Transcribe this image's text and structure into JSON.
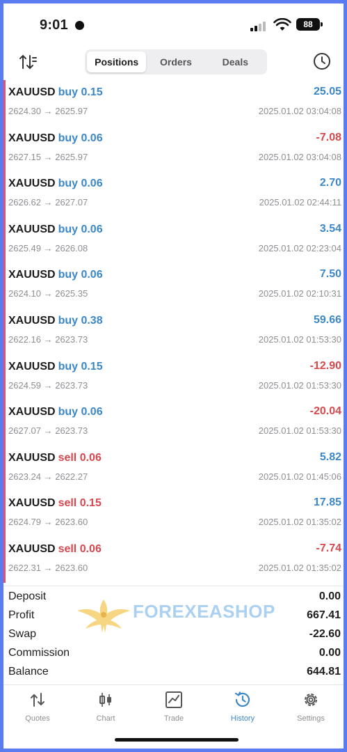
{
  "status_bar": {
    "time": "9:01",
    "battery": "88"
  },
  "toolbar": {
    "tabs": [
      {
        "label": "Positions",
        "active": true
      },
      {
        "label": "Orders",
        "active": false
      },
      {
        "label": "Deals",
        "active": false
      }
    ],
    "sort_icon": "sort-icon",
    "history_icon": "clock-icon"
  },
  "deals": [
    {
      "symbol": "XAUUSD",
      "side": "buy 0.15",
      "direction": "buy",
      "prices": "2624.30 → 2625.97",
      "profit": "25.05",
      "sign": "pos",
      "date": "2025.01.02 03:04:08"
    },
    {
      "symbol": "XAUUSD",
      "side": "buy 0.06",
      "direction": "buy",
      "prices": "2627.15 → 2625.97",
      "profit": "-7.08",
      "sign": "neg",
      "date": "2025.01.02 03:04:08"
    },
    {
      "symbol": "XAUUSD",
      "side": "buy 0.06",
      "direction": "buy",
      "prices": "2626.62 → 2627.07",
      "profit": "2.70",
      "sign": "pos",
      "date": "2025.01.02 02:44:11"
    },
    {
      "symbol": "XAUUSD",
      "side": "buy 0.06",
      "direction": "buy",
      "prices": "2625.49 → 2626.08",
      "profit": "3.54",
      "sign": "pos",
      "date": "2025.01.02 02:23:04"
    },
    {
      "symbol": "XAUUSD",
      "side": "buy 0.06",
      "direction": "buy",
      "prices": "2624.10 → 2625.35",
      "profit": "7.50",
      "sign": "pos",
      "date": "2025.01.02 02:10:31"
    },
    {
      "symbol": "XAUUSD",
      "side": "buy 0.38",
      "direction": "buy",
      "prices": "2622.16 → 2623.73",
      "profit": "59.66",
      "sign": "pos",
      "date": "2025.01.02 01:53:30"
    },
    {
      "symbol": "XAUUSD",
      "side": "buy 0.15",
      "direction": "buy",
      "prices": "2624.59 → 2623.73",
      "profit": "-12.90",
      "sign": "neg",
      "date": "2025.01.02 01:53:30"
    },
    {
      "symbol": "XAUUSD",
      "side": "buy 0.06",
      "direction": "buy",
      "prices": "2627.07 → 2623.73",
      "profit": "-20.04",
      "sign": "neg",
      "date": "2025.01.02 01:53:30"
    },
    {
      "symbol": "XAUUSD",
      "side": "sell 0.06",
      "direction": "sell",
      "prices": "2623.24 → 2622.27",
      "profit": "5.82",
      "sign": "pos",
      "date": "2025.01.02 01:45:06"
    },
    {
      "symbol": "XAUUSD",
      "side": "sell 0.15",
      "direction": "sell",
      "prices": "2624.79 → 2623.60",
      "profit": "17.85",
      "sign": "pos",
      "date": "2025.01.02 01:35:02"
    },
    {
      "symbol": "XAUUSD",
      "side": "sell 0.06",
      "direction": "sell",
      "prices": "2622.31 → 2623.60",
      "profit": "-7.74",
      "sign": "neg",
      "date": "2025.01.02 01:35:02"
    }
  ],
  "summary": [
    {
      "label": "Deposit",
      "value": "0.00"
    },
    {
      "label": "Profit",
      "value": "667.41"
    },
    {
      "label": "Swap",
      "value": "-22.60"
    },
    {
      "label": "Commission",
      "value": "0.00"
    },
    {
      "label": "Balance",
      "value": "644.81"
    }
  ],
  "watermark": {
    "text": "FOREXEASHOP"
  },
  "tab_bar": [
    {
      "label": "Quotes",
      "icon": "quotes-icon",
      "active": false
    },
    {
      "label": "Chart",
      "icon": "chart-icon",
      "active": false
    },
    {
      "label": "Trade",
      "icon": "trade-icon",
      "active": false
    },
    {
      "label": "History",
      "icon": "history-icon",
      "active": true
    },
    {
      "label": "Settings",
      "icon": "settings-icon",
      "active": false
    }
  ],
  "colors": {
    "buy": "#3b87c8",
    "sell": "#d6484c",
    "positive": "#3b87c8",
    "negative": "#d6484c",
    "active_tab": "#3b87c8",
    "frame": "#5b7cf0"
  }
}
